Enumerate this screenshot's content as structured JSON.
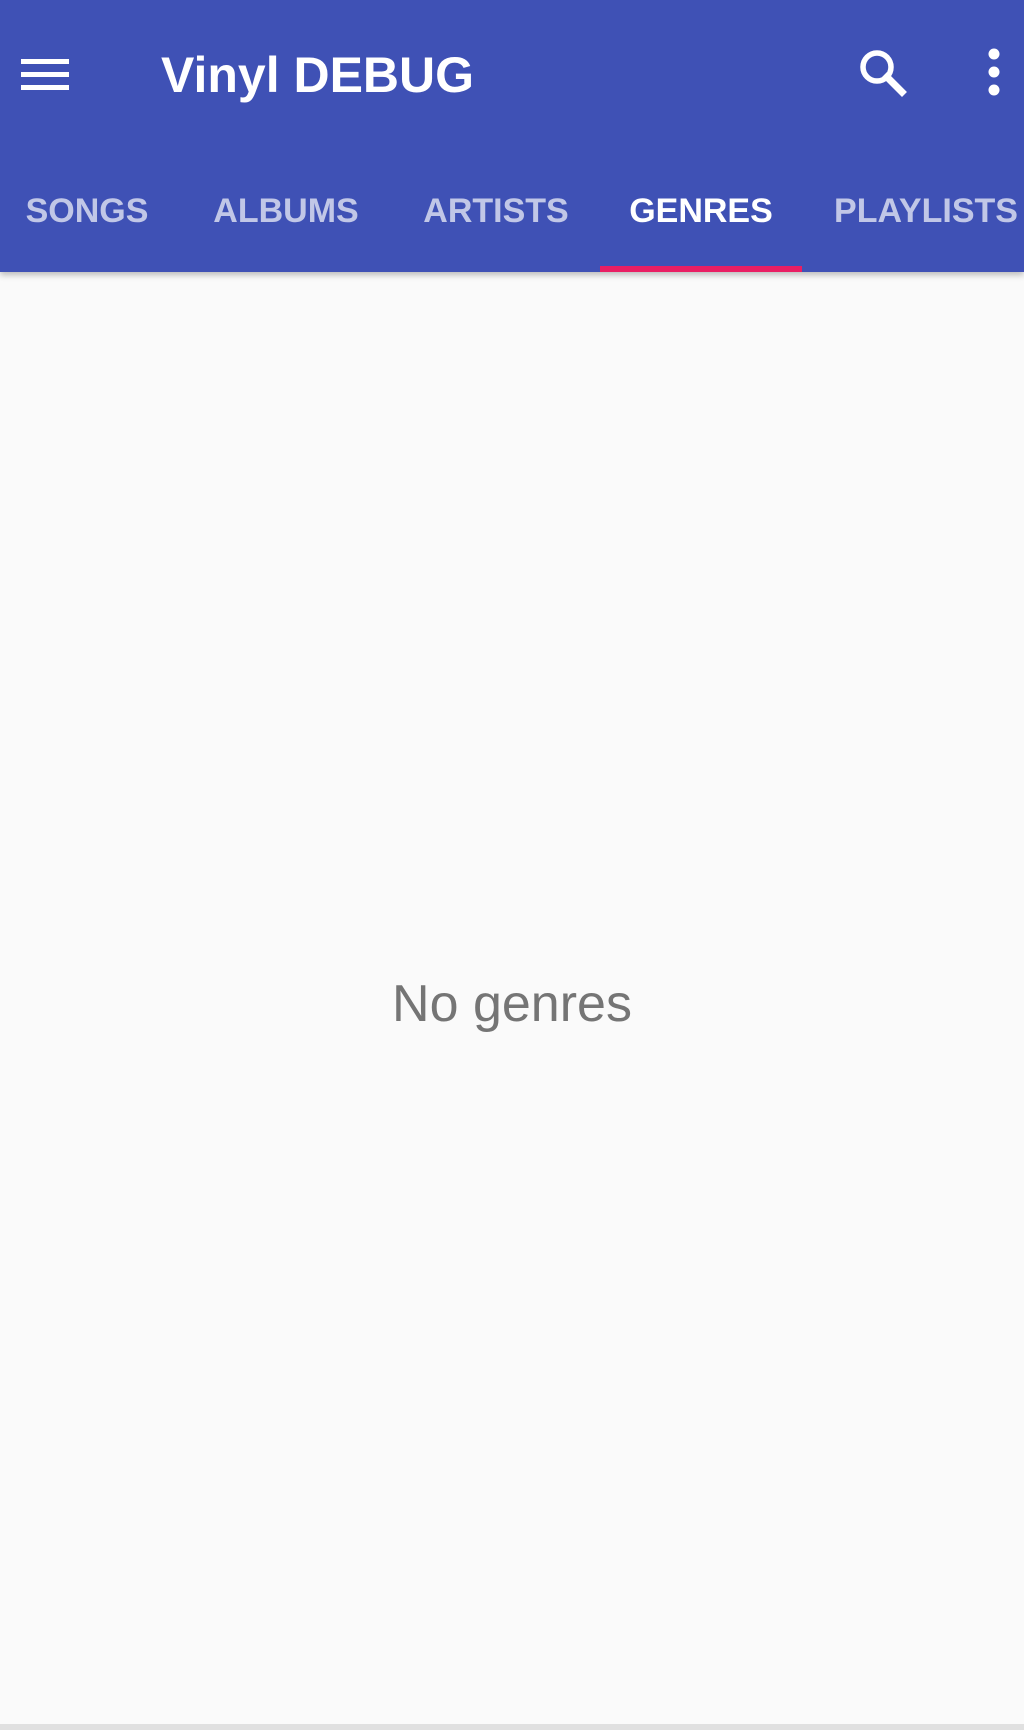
{
  "colors": {
    "primary": "#3f51b5",
    "accent": "#e91e63",
    "background": "#fafafa",
    "empty_text": "#757575"
  },
  "toolbar": {
    "menu_icon": "hamburger-menu-icon",
    "title": "Vinyl DEBUG",
    "search_icon": "search-icon",
    "more_icon": "more-vert-icon"
  },
  "tabs": [
    {
      "label": "SONGS",
      "active": false
    },
    {
      "label": "ALBUMS",
      "active": false
    },
    {
      "label": "ARTISTS",
      "active": false
    },
    {
      "label": "GENRES",
      "active": true
    },
    {
      "label": "PLAYLISTS",
      "active": false
    }
  ],
  "content": {
    "empty_message": "No genres"
  }
}
